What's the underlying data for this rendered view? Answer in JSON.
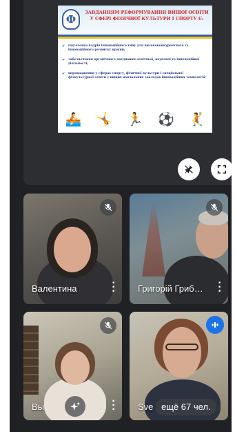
{
  "presentation": {
    "slide_title_line1": "ЗАВДАННЯМ РЕФОРМУВАННЯ ВИЩОЇ ОСВІТИ",
    "slide_title_line2": "У СФЕРІ ФІЗИЧНОЇ КУЛЬТУРИ І СПОРТУ Є:",
    "bullets": [
      "підготовка кадрів інноваційного типу для висококонкурентного та інноваційного розвитку країни;",
      "забезпечення органічного поєднання освітньої, наукової та інноваційної діяльності;",
      "впровадження у сферах спорту, фізичної культури і спеціальної фізкультурної освіти у вищих навчальних закладах інноваційних технологій"
    ],
    "pin_icon": "pin-off-icon",
    "fullscreen_icon": "fullscreen-icon"
  },
  "participants": [
    {
      "name": "Валентина",
      "mic": "muted"
    },
    {
      "name": "Григорій Гриб…",
      "mic": "muted"
    },
    {
      "name": "Вы",
      "mic": "muted"
    },
    {
      "name": "Sve",
      "mic": "speaking"
    }
  ],
  "overflow": {
    "label": "ещё 67 чел."
  },
  "colors": {
    "speaking": "#1a73e8",
    "background": "#202124",
    "tile": "#3c4043"
  }
}
